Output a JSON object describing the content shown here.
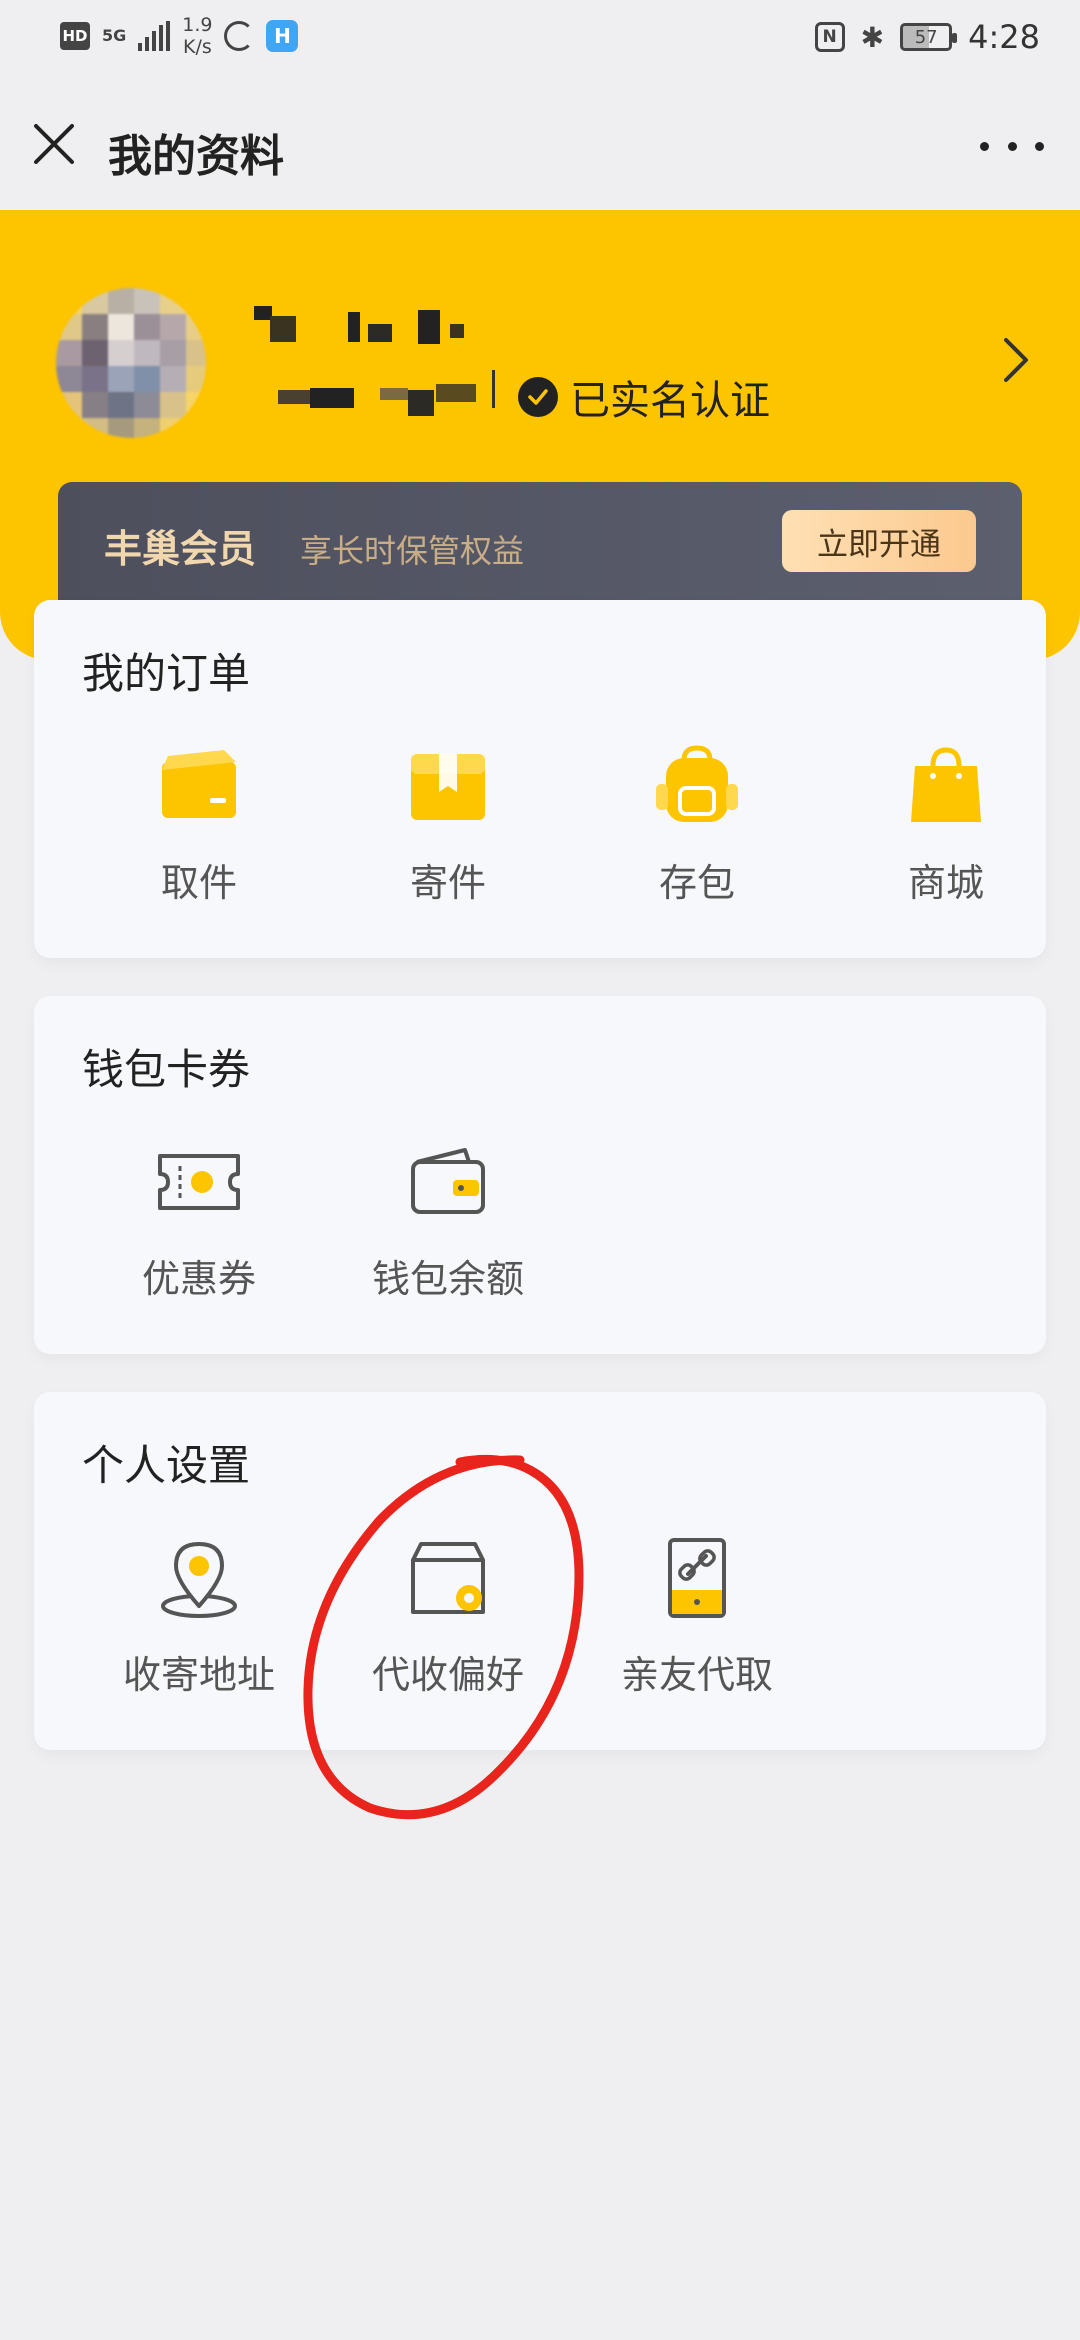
{
  "status_bar": {
    "hd": "HD",
    "network": "5G",
    "speed_value": "1.9",
    "speed_unit": "K/s",
    "app_badge": "H",
    "battery": "57",
    "time": "4:28"
  },
  "nav": {
    "title": "我的资料"
  },
  "profile": {
    "verified_label": "已实名认证"
  },
  "vip": {
    "title": "丰巢会员",
    "subtitle": "享长时保管权益",
    "button": "立即开通"
  },
  "orders": {
    "title": "我的订单",
    "items": [
      {
        "label": "取件",
        "icon": "pickup-icon"
      },
      {
        "label": "寄件",
        "icon": "send-package-icon"
      },
      {
        "label": "存包",
        "icon": "backpack-icon"
      },
      {
        "label": "商城",
        "icon": "shopping-bag-icon"
      }
    ]
  },
  "wallet": {
    "title": "钱包卡券",
    "items": [
      {
        "label": "优惠券",
        "icon": "coupon-icon"
      },
      {
        "label": "钱包余额",
        "icon": "wallet-icon"
      }
    ]
  },
  "settings": {
    "title": "个人设置",
    "items": [
      {
        "label": "收寄地址",
        "icon": "location-pin-icon"
      },
      {
        "label": "代收偏好",
        "icon": "box-settings-icon"
      },
      {
        "label": "亲友代取",
        "icon": "link-phone-icon"
      }
    ]
  },
  "colors": {
    "brand_yellow": "#fdc400",
    "vip_dark": "#4d4f5d",
    "vip_gold": "#f1d7ae",
    "annotation_red": "#e8241c"
  }
}
